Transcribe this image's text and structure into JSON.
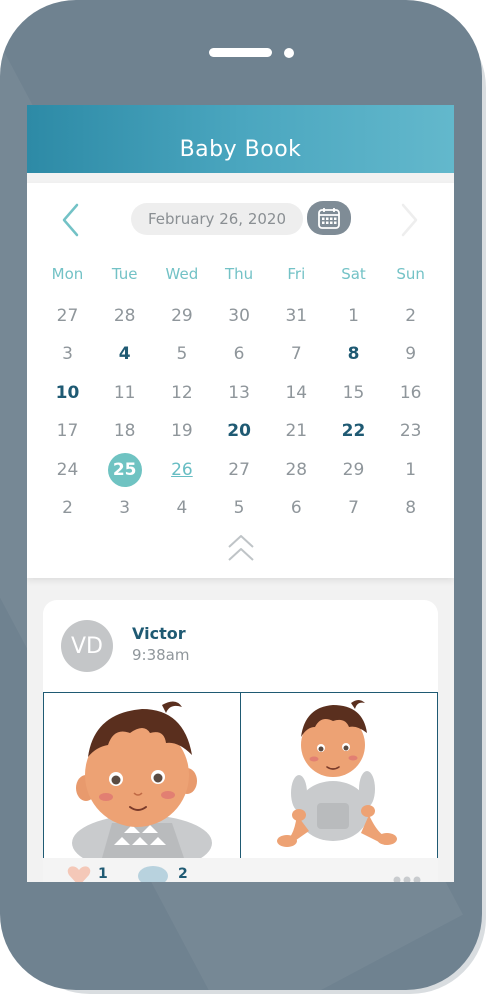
{
  "app": {
    "title": "Baby Book"
  },
  "calendar": {
    "selected_date_label": "February 26, 2020",
    "weekdays": [
      "Mon",
      "Tue",
      "Wed",
      "Thu",
      "Fri",
      "Sat",
      "Sun"
    ],
    "weeks": [
      [
        {
          "d": "27"
        },
        {
          "d": "28"
        },
        {
          "d": "29"
        },
        {
          "d": "30"
        },
        {
          "d": "31"
        },
        {
          "d": "1"
        },
        {
          "d": "2"
        }
      ],
      [
        {
          "d": "3"
        },
        {
          "d": "4",
          "bold": true
        },
        {
          "d": "5"
        },
        {
          "d": "6"
        },
        {
          "d": "7"
        },
        {
          "d": "8",
          "bold": true
        },
        {
          "d": "9"
        }
      ],
      [
        {
          "d": "10",
          "bold": true
        },
        {
          "d": "11"
        },
        {
          "d": "12"
        },
        {
          "d": "13"
        },
        {
          "d": "14"
        },
        {
          "d": "15"
        },
        {
          "d": "16"
        }
      ],
      [
        {
          "d": "17"
        },
        {
          "d": "18"
        },
        {
          "d": "19"
        },
        {
          "d": "20",
          "bold": true
        },
        {
          "d": "21"
        },
        {
          "d": "22",
          "bold": true
        },
        {
          "d": "23"
        }
      ],
      [
        {
          "d": "24"
        },
        {
          "d": "25",
          "selected": true
        },
        {
          "d": "26",
          "link": true
        },
        {
          "d": "27"
        },
        {
          "d": "28"
        },
        {
          "d": "29"
        },
        {
          "d": "1"
        }
      ],
      [
        {
          "d": "2"
        },
        {
          "d": "3"
        },
        {
          "d": "4"
        },
        {
          "d": "5"
        },
        {
          "d": "6"
        },
        {
          "d": "7"
        },
        {
          "d": "8"
        }
      ]
    ],
    "icons": {
      "prev": "chevron-left-icon",
      "next": "chevron-right-icon",
      "calendar": "calendar-icon",
      "collapse": "double-chevron-up-icon"
    }
  },
  "post": {
    "avatar_initials": "VD",
    "author": "Victor",
    "time": "9:38am",
    "likes": "1",
    "comments": "2"
  },
  "colors": {
    "header_start": "#2d8aa6",
    "header_end": "#63b8cc",
    "accent_teal": "#6fc3c2",
    "dark_navy": "#1f5a73",
    "phone_body": "#6f8290"
  }
}
